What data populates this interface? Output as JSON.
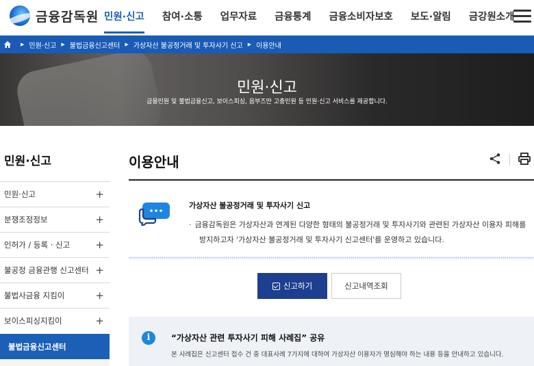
{
  "header": {
    "logo_text": "금융감독원",
    "nav": [
      "민원·신고",
      "참여·소통",
      "업무자료",
      "금융통계",
      "금융소비자보호",
      "보도·알림",
      "금강원소개"
    ]
  },
  "breadcrumb": [
    "민원·신고",
    "불법금융신고센터",
    "가상자산 불공정거래 및 투자사기 신고",
    "이용안내"
  ],
  "hero": {
    "title": "민원·신고",
    "subtitle": "금융민원 및 불법금융신고, 보이스피싱, 음부즈만 고충민원 등 민원·신고 서비스를 제공합니다."
  },
  "sidebar": {
    "title": "민원·신고",
    "items": [
      {
        "label": "민원·신고",
        "expand": "+"
      },
      {
        "label": "분쟁조정정보",
        "expand": "+"
      },
      {
        "label": "인허가 / 등록 · 신고",
        "expand": "+"
      },
      {
        "label": "불공정 금융관행 신고센터",
        "expand": "+"
      },
      {
        "label": "불법사금융 지킴이",
        "expand": "+"
      },
      {
        "label": "보이스피싱지킴이",
        "expand": "+"
      },
      {
        "label": "불법금융신고센터",
        "expand": ""
      }
    ]
  },
  "main": {
    "page_title": "이용안내",
    "notice_title": "가상자산 불공정거래 및 투자사기 신고",
    "notice_bullet": "·",
    "notice_line1": "금융감독원은 가상자산과 연계된 다양한 형태의 불공정거래 및 투자사기와 관련된 가상자산 이용자 피해를",
    "notice_line2": "방지하고자 '가상자산 불공정거래 및 투자사기 신고센터'를 운영하고 있습니다.",
    "report_button": "신고하기",
    "history_button": "신고내역조회",
    "info_title": "“가상자산 관련 투자사기 피해 사례집” 공유",
    "info_body": "본 사례집은 신고센터 접수 건 중 대표사례 7가지에 대하여 가상자산 이용자가 명심해야 하는 내용 등을 안내하고 있습니다.",
    "info_glyph": "i"
  },
  "colors": {
    "brand_blue": "#1b5fb7",
    "button_navy": "#1e3f8f",
    "info_bg": "#eef1f6"
  },
  "icons": [
    "logo-icon",
    "home-icon",
    "share-icon",
    "print-icon",
    "chat-bubble-icon",
    "info-icon",
    "calendar-check-icon",
    "menu-icon"
  ]
}
